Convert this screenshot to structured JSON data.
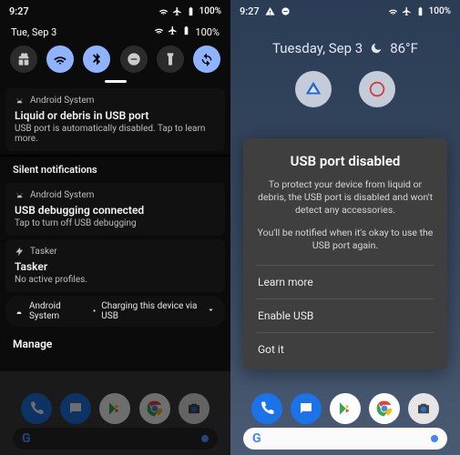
{
  "left": {
    "status": {
      "time": "9:27",
      "battery": "100%"
    },
    "date": "Tue, Sep 3",
    "qs": {
      "tiles": [
        {
          "name": "gift-icon",
          "on": false
        },
        {
          "name": "wifi-icon",
          "on": true
        },
        {
          "name": "bluetooth-icon",
          "on": true
        },
        {
          "name": "dnd-icon",
          "on": false
        },
        {
          "name": "flashlight-icon",
          "on": false
        },
        {
          "name": "autorotate-icon",
          "on": true
        }
      ]
    },
    "notifs": [
      {
        "app": "Android System",
        "title": "Liquid or debris in USB port",
        "sub": "USB port is automatically disabled. Tap to learn more."
      }
    ],
    "silent_label": "Silent notifications",
    "silent": [
      {
        "app": "Android System",
        "title": "USB debugging connected",
        "sub": "Tap to turn off USB debugging"
      },
      {
        "app": "Tasker",
        "title": "Tasker",
        "sub": "No active profiles."
      }
    ],
    "foot": {
      "app": "Android System",
      "text": "Charging this device via USB"
    },
    "manage": "Manage"
  },
  "right": {
    "status": {
      "time": "9:27",
      "battery": "100%"
    },
    "date": "Tuesday, Sep 3",
    "temp": "86°F",
    "dialog": {
      "title": "USB port disabled",
      "body1": "To protect your device from liquid or debris, the USB port is disabled and won't detect any accessories.",
      "body2": "You'll be notified when it's okay to use the USB port again.",
      "actions": [
        "Learn more",
        "Enable USB",
        "Got it"
      ]
    }
  }
}
